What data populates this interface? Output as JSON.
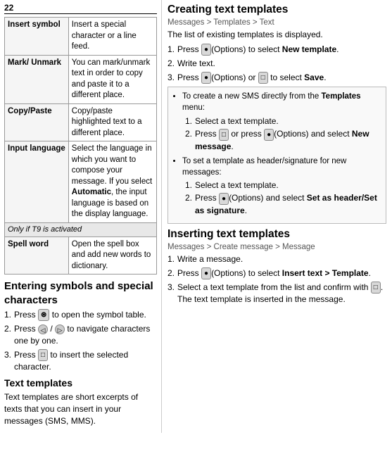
{
  "page_number": "22",
  "left": {
    "table_rows": [
      {
        "label": "Insert symbol",
        "desc": "Insert a special character or a line feed."
      },
      {
        "label": "Mark/ Unmark",
        "desc": "You can mark/unmark text in order to copy and paste it to a different place."
      },
      {
        "label": "Copy/Paste",
        "desc": "Copy/paste highlighted text to a different place."
      },
      {
        "label": "Input language",
        "desc": "Select the language in which you want to compose your message. If you select Automatic, the input language is based on the display language."
      }
    ],
    "only_if_text": "Only if T9 is activated",
    "spell_word_label": "Spell word",
    "spell_word_desc": "Open the spell box and add new words to dictionary."
  },
  "left_section": {
    "heading": "Entering symbols and special characters",
    "steps": [
      {
        "num": "1.",
        "text_before": "Press",
        "btn": "⊛",
        "text_after": "to open the symbol table."
      },
      {
        "num": "2.",
        "text_before": "Press",
        "btn1": "◁",
        "slash": " / ",
        "btn2": "▷",
        "text_after": "to navigate characters one by one."
      },
      {
        "num": "3.",
        "text_before": "Press",
        "btn": "□",
        "text_after": "to insert the selected character."
      }
    ],
    "text_templates_heading": "Text templates",
    "text_templates_desc": "Text templates are short excerpts of texts that you can insert in your messages (SMS, MMS)."
  },
  "right": {
    "creating_heading": "Creating text templates",
    "creating_path": "Messages > Templates > Text",
    "creating_intro": "The list of existing templates is displayed.",
    "creating_steps": [
      {
        "num": "1.",
        "text": "Press",
        "btn_label": "•",
        "btn_text": "(Options)",
        "rest": "to select New template."
      },
      {
        "num": "2.",
        "text": "Write text."
      },
      {
        "num": "3.",
        "text": "Press",
        "btn_label": "•",
        "btn_text": "(Options)",
        "or": "or",
        "btn2": "□",
        "rest": "to select Save."
      }
    ],
    "info_box": {
      "bullets": [
        {
          "intro": "To create a new SMS directly from the Templates menu:",
          "sub_steps": [
            {
              "num": "1.",
              "text": "Select a text template."
            },
            {
              "num": "2.",
              "text": "Press",
              "btn_label": "□",
              "or": "or press",
              "btn2_label": "•",
              "btn2_text": "(Options)",
              "rest": "and select New message."
            }
          ]
        },
        {
          "intro": "To set a template as header/signature for new messages:",
          "sub_steps": [
            {
              "num": "1.",
              "text": "Select a text template."
            },
            {
              "num": "2.",
              "text": "Press",
              "btn_label": "•",
              "btn_text": "(Options)",
              "rest": "and select Set as header/Set as signature."
            }
          ]
        }
      ]
    },
    "inserting_heading": "Inserting text templates",
    "inserting_path": "Messages > Create message > Message",
    "inserting_steps": [
      {
        "num": "1.",
        "text": "Write a message."
      },
      {
        "num": "2.",
        "text": "Press",
        "btn_label": "•",
        "btn_text": "(Options)",
        "rest": "to select Insert text > Template."
      },
      {
        "num": "3.",
        "text": "Select a text template from the list and confirm with",
        "btn": "□",
        "rest": ". The text template is inserted in the message."
      }
    ]
  }
}
